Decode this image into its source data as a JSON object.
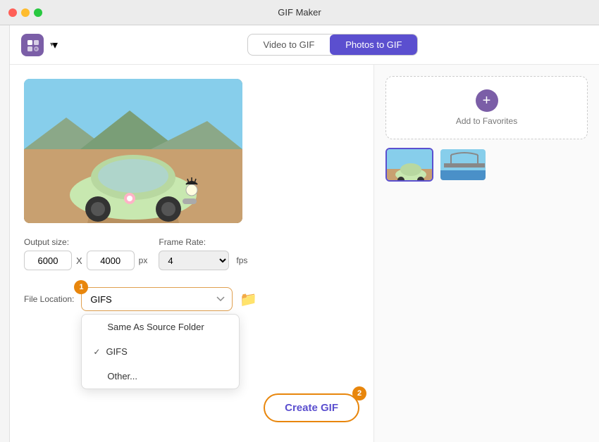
{
  "titleBar": {
    "title": "GIF Maker"
  },
  "toolbar": {
    "logoIcon": "app-logo",
    "tabs": [
      {
        "id": "video-to-gif",
        "label": "Video to GIF",
        "active": false
      },
      {
        "id": "photos-to-gif",
        "label": "Photos to GIF",
        "active": true
      }
    ]
  },
  "favorites": {
    "addLabel": "Add to Favorites",
    "addIcon": "+"
  },
  "thumbnails": [
    {
      "id": "thumb-1",
      "label": "Car photo 1"
    },
    {
      "id": "thumb-2",
      "label": "Bridge photo 2"
    }
  ],
  "settings": {
    "outputSizeLabel": "Output size:",
    "width": "6000",
    "height": "4000",
    "px": "px",
    "xSeparator": "X",
    "frameRateLabel": "Frame Rate:",
    "frameRateValue": "4",
    "fps": "fps"
  },
  "fileLocation": {
    "label": "File Location:",
    "selectedOption": "GIFS",
    "options": [
      {
        "id": "same-as-source",
        "label": "Same As Source Folder",
        "checked": false
      },
      {
        "id": "gifs",
        "label": "GIFS",
        "checked": true
      },
      {
        "id": "other",
        "label": "Other...",
        "checked": false
      }
    ]
  },
  "badges": {
    "badge1": "1",
    "badge2": "2"
  },
  "createGif": {
    "label": "Create GIF"
  },
  "help": {
    "icon": "?"
  }
}
